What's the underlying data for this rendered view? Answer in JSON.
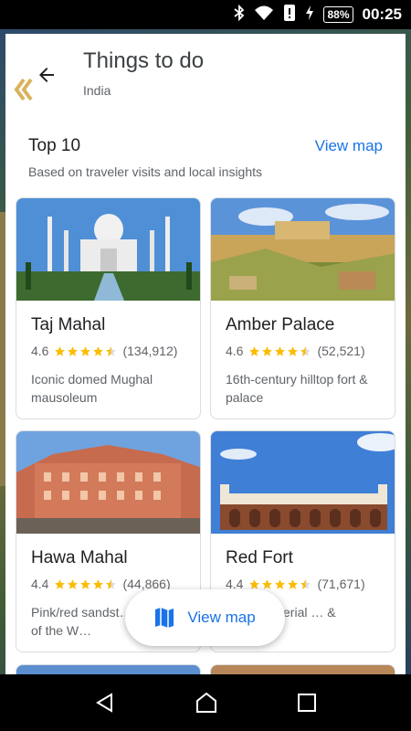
{
  "status_bar": {
    "battery": "88%",
    "time": "00:25",
    "icons": [
      "bluetooth-icon",
      "wifi-icon",
      "alert-icon",
      "charging-icon"
    ]
  },
  "header": {
    "title": "Things to do",
    "subtitle": "India",
    "back_icon": "arrow-back-icon"
  },
  "section": {
    "title": "Top 10",
    "subtitle": "Based on traveler visits and local insights",
    "view_map_label": "View map"
  },
  "cards": [
    {
      "name": "Taj Mahal",
      "rating": "4.6",
      "stars": 4.5,
      "reviews": "(134,912)",
      "description": "Iconic domed Mughal mausoleum"
    },
    {
      "name": "Amber Palace",
      "rating": "4.6",
      "stars": 4.5,
      "reviews": "(52,521)",
      "description": "16th-century hilltop fort & palace"
    },
    {
      "name": "Hawa Mahal",
      "rating": "4.4",
      "stars": 4.5,
      "reviews": "(44,866)",
      "description": "Pink/red sandst… 'Palace of the W…"
    },
    {
      "name": "Red Fort",
      "rating": "4.4",
      "stars": 4.5,
      "reviews": "(71,671)",
      "description": "…00s imperial … & museum"
    }
  ],
  "fab": {
    "label": "View map",
    "icon": "map-icon"
  },
  "colors": {
    "accent": "#1a73e8",
    "star": "#fbbc04"
  },
  "nav": {
    "icons": [
      "back-triangle-icon",
      "home-circle-icon",
      "recents-square-icon"
    ]
  }
}
